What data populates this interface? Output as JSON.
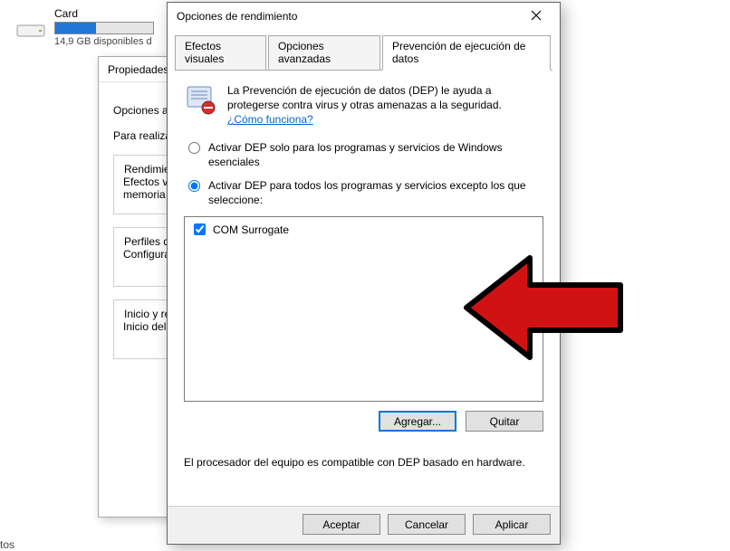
{
  "drive": {
    "label": "Card",
    "subtext": "14,9 GB disponibles d"
  },
  "back_dialog": {
    "title": "Propiedades d",
    "opts_label": "Opciones a",
    "lead_text": "Para realiza",
    "sec_perf": {
      "legend": "Rendimien",
      "line1": "Efectos vis",
      "line2": "memoria v"
    },
    "sec_profiles": {
      "legend": "Perfiles de",
      "line1": "Configurac"
    },
    "sec_startup": {
      "legend": "Inicio y rec",
      "line1": "Inicio del s"
    }
  },
  "front_dialog": {
    "title": "Opciones de rendimiento",
    "tabs": {
      "visual": "Efectos visuales",
      "advanced": "Opciones avanzadas",
      "dep": "Prevención de ejecución de datos"
    },
    "dep": {
      "intro": "La Prevención de ejecución de datos (DEP) le ayuda a protegerse contra virus y otras amenazas a la seguridad.",
      "intro_link": "¿Cómo funciona?",
      "radio_essential": "Activar DEP solo para los programas y servicios de Windows esenciales",
      "radio_all": "Activar DEP para todos los programas y servicios excepto los que seleccione:",
      "list": {
        "item0": "COM Surrogate"
      },
      "add_btn": "Agregar...",
      "remove_btn": "Quitar",
      "compat": "El procesador del equipo es compatible con DEP basado en hardware."
    },
    "footer": {
      "ok": "Aceptar",
      "cancel": "Cancelar",
      "apply": "Aplicar"
    }
  },
  "bottom_fragment": "tos"
}
